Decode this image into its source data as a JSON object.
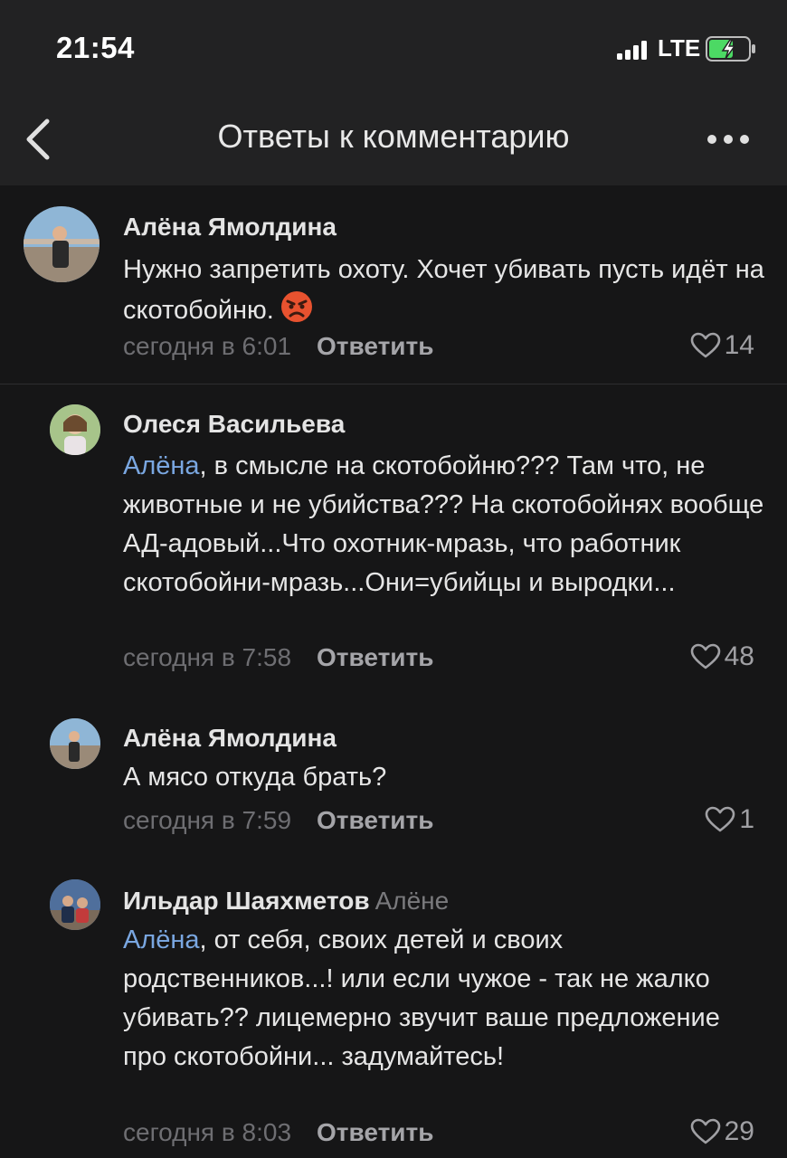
{
  "status_bar": {
    "time": "21:54",
    "network": "LTE",
    "battery_charging": true
  },
  "nav": {
    "title": "Ответы к комментарию"
  },
  "comments": [
    {
      "author": "Алёна Ямолдина",
      "text": "Нужно запретить охоту. Хочет убивать пусть идёт на скотобойню.",
      "emoji": "angry-face",
      "time": "сегодня в 6:01",
      "reply_label": "Ответить",
      "likes": "14"
    },
    {
      "author": "Олеся Васильева",
      "mention": "Алёна",
      "text": ", в смысле на скотобойню??? Там что, не животные и не убийства??? На скотобойнях вообще АД-адовый...Что охотник-мразь, что работник скотобойни-мразь...Они=убийцы и выродки...",
      "time": "сегодня в 7:58",
      "reply_label": "Ответить",
      "likes": "48"
    },
    {
      "author": "Алёна Ямолдина",
      "text": "А мясо откуда брать?",
      "time": "сегодня в 7:59",
      "reply_label": "Ответить",
      "likes": "1"
    },
    {
      "author": "Ильдар Шаяхметов",
      "reply_to": "Алёне",
      "mention": "Алёна",
      "text": ", от себя, своих детей и своих родственников...! или если чужое - так не жалко убивать?? лицемерно звучит ваше предложение про скотобойни... задумайтесь!",
      "time": "сегодня в 8:03",
      "reply_label": "Ответить",
      "likes": "29"
    }
  ],
  "colors": {
    "background": "#161617",
    "bar": "#222223",
    "mention": "#7aa7e1",
    "battery": "#4cd964"
  }
}
